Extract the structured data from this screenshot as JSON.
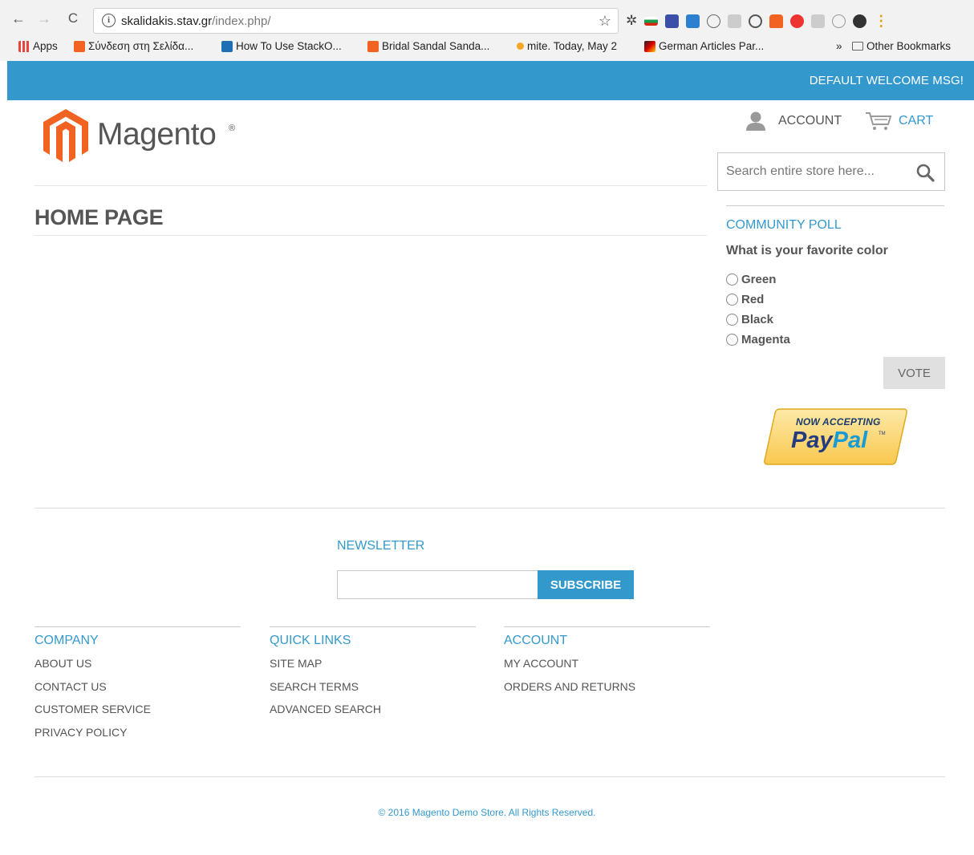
{
  "browser": {
    "url_host": "skalidakis.stav.gr",
    "url_path": "/index.php/",
    "bookmarks": [
      {
        "label": "Apps",
        "icon": "apps-grid-icon",
        "color": "#e8453c"
      },
      {
        "label": "Σύνδεση στη Σελίδα...",
        "icon": "magento-icon",
        "color": "#f26322"
      },
      {
        "label": "How To Use StackO...",
        "icon": "e-icon",
        "color": "#1f6fb5"
      },
      {
        "label": "Bridal Sandal Sanda...",
        "icon": "magento-icon",
        "color": "#f26322"
      },
      {
        "label": "mite. Today, May 2",
        "icon": "orange-dot-icon",
        "color": "#f5a623"
      },
      {
        "label": "German Articles Par...",
        "icon": "flag-icon",
        "color": "#f0c000"
      }
    ],
    "overflow_label": "»",
    "other_bookmarks": "Other Bookmarks",
    "nav": {
      "back": "←",
      "forward": "→",
      "reload": "C"
    }
  },
  "header": {
    "welcome": "DEFAULT WELCOME MSG!",
    "logo_text": "Magento",
    "logo_reg": "®",
    "account_label": "ACCOUNT",
    "cart_label": "CART",
    "search_placeholder": "Search entire store here..."
  },
  "main": {
    "page_title": "HOME PAGE"
  },
  "poll": {
    "title": "COMMUNITY POLL",
    "question": "What is your favorite color",
    "options": [
      "Green",
      "Red",
      "Black",
      "Magenta"
    ],
    "vote_label": "VOTE"
  },
  "paypal": {
    "line1": "NOW ACCEPTING",
    "pay": "Pay",
    "pal": "Pal",
    "tm": "TM"
  },
  "newsletter": {
    "title": "NEWSLETTER",
    "subscribe_label": "SUBSCRIBE",
    "input_value": ""
  },
  "footer": {
    "columns": [
      {
        "title": "COMPANY",
        "links": [
          "ABOUT US",
          "CONTACT US",
          "CUSTOMER SERVICE",
          "PRIVACY POLICY"
        ]
      },
      {
        "title": "QUICK LINKS",
        "links": [
          "SITE MAP",
          "SEARCH TERMS",
          "ADVANCED SEARCH"
        ]
      },
      {
        "title": "ACCOUNT",
        "links": [
          "MY ACCOUNT",
          "ORDERS AND RETURNS"
        ]
      }
    ],
    "copyright": "© 2016 Magento Demo Store. All Rights Reserved."
  },
  "colors": {
    "accent": "#3399cc",
    "magento_orange": "#f26322",
    "text": "#555555"
  }
}
